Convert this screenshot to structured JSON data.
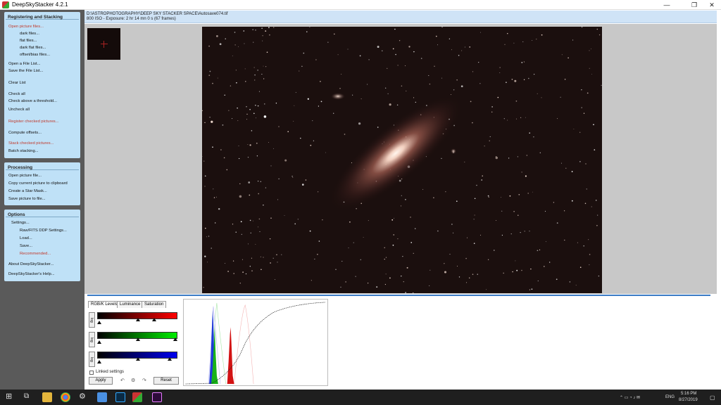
{
  "window": {
    "title": "DeepSkyStacker 4.2.1",
    "minimize": "—",
    "maximize": "❐",
    "close": "✕"
  },
  "registering": {
    "title": "Registering and Stacking",
    "items": [
      "Open picture files...",
      "dark files...",
      "flat files...",
      "dark flat files...",
      "offset/bias files...",
      "Open a File List...",
      "Save the File List...",
      "Clear List",
      "Check all",
      "Check above a threshold...",
      "Uncheck all",
      "Register checked pictures...",
      "Compute offsets...",
      "Stack checked pictures...",
      "Batch stacking..."
    ]
  },
  "processing": {
    "title": "Processing",
    "items": [
      "Open picture file...",
      "Copy current picture to clipboard",
      "Create a Star Mask...",
      "Save picture to file..."
    ]
  },
  "options": {
    "title": "Options",
    "items": [
      "Settings...",
      "Raw/FITS DDP Settings...",
      "Load...",
      "Save...",
      "Recommended...",
      "About DeepSkyStacker...",
      "DeepSkyStacker's Help..."
    ]
  },
  "info": {
    "path": "D:\\ASTROPHOTOGRAPHY\\DEEP SKY STACKER SPACE\\Autosave074.tif",
    "exposure": "800 ISO - Exposure: 2 hr 14 mn 0 s (67 frames)"
  },
  "tabs": [
    "RGB/K Levels",
    "Luminance",
    "Saturation"
  ],
  "levels": {
    "log_label": "log",
    "linked_label": "Linked settings",
    "apply_label": "Apply",
    "reset_label": "Reset"
  },
  "taskbar": {
    "lang": "ENG",
    "time": "5:16 PM",
    "date": "8/27/2019"
  }
}
